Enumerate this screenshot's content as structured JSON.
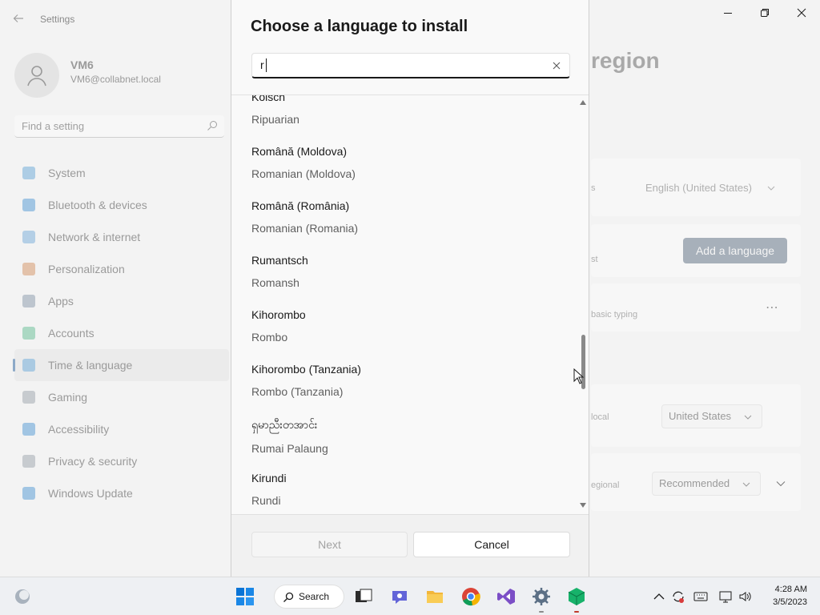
{
  "settings": {
    "app_title": "Settings",
    "user": {
      "name": "VM6",
      "email": "VM6@collabnet.local"
    },
    "find_placeholder": "Find a setting",
    "nav": [
      {
        "label": "System",
        "icon": "monitor-icon",
        "color": "#7fb4dc"
      },
      {
        "label": "Bluetooth & devices",
        "icon": "bluetooth-icon",
        "color": "#6aa6d8"
      },
      {
        "label": "Network & internet",
        "icon": "wifi-icon",
        "color": "#8ab7dd"
      },
      {
        "label": "Personalization",
        "icon": "brush-icon",
        "color": "#d9a27a"
      },
      {
        "label": "Apps",
        "icon": "apps-icon",
        "color": "#9aa7b5"
      },
      {
        "label": "Accounts",
        "icon": "person-icon",
        "color": "#7cc7a4"
      },
      {
        "label": "Time & language",
        "icon": "globe-clock-icon",
        "color": "#7fb4dc",
        "active": true
      },
      {
        "label": "Gaming",
        "icon": "controller-icon",
        "color": "#aab1b8"
      },
      {
        "label": "Accessibility",
        "icon": "accessibility-icon",
        "color": "#6aa6d8"
      },
      {
        "label": "Privacy & security",
        "icon": "shield-icon",
        "color": "#aab1b8"
      },
      {
        "label": "Windows Update",
        "icon": "update-icon",
        "color": "#6aa6d8"
      }
    ],
    "page_heading_fragment": "region",
    "cards": {
      "display_lang_label": "s",
      "display_lang_value": "English (United States)",
      "preferred_label": "st",
      "add_language": "Add a language",
      "typing_label": "basic typing",
      "country_label": "local",
      "country_value": "United States",
      "format_label": "egional",
      "format_value": "Recommended"
    }
  },
  "dialog": {
    "title": "Choose a language to install",
    "search_value": "r",
    "items": [
      {
        "native": "Kölsch",
        "english": "Ripuarian"
      },
      {
        "native": "Română (Moldova)",
        "english": "Romanian (Moldova)"
      },
      {
        "native": "Română (România)",
        "english": "Romanian (Romania)"
      },
      {
        "native": "Rumantsch",
        "english": "Romansh"
      },
      {
        "native": "Kihorombo",
        "english": "Rombo"
      },
      {
        "native": "Kihorombo (Tanzania)",
        "english": "Rombo (Tanzania)"
      },
      {
        "native": "ရှမာညီးတအာင်း",
        "english": "Rumai Palaung"
      },
      {
        "native": "Kirundi",
        "english": "Rundi"
      }
    ],
    "next_label": "Next",
    "cancel_label": "Cancel"
  },
  "taskbar": {
    "search_label": "Search",
    "time": "4:28 AM",
    "date": "3/5/2023"
  }
}
